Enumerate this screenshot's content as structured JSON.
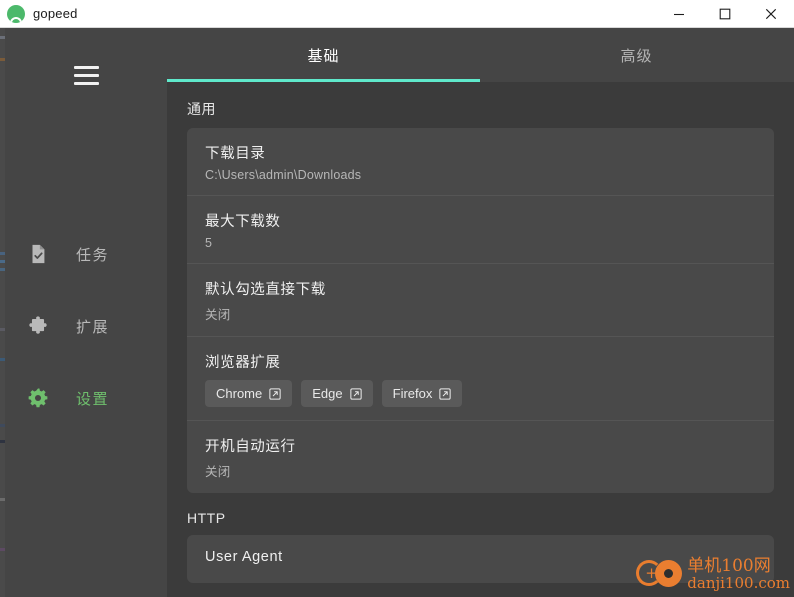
{
  "window": {
    "title": "gopeed",
    "logo_icon": "gopeed-logo-icon",
    "controls": {
      "minimize": "minimize-icon",
      "maximize": "maximize-icon",
      "close": "close-icon"
    }
  },
  "sidebar": {
    "menu_icon": "hamburger-menu-icon",
    "items": [
      {
        "label": "任务",
        "icon": "task-document-icon",
        "active": false
      },
      {
        "label": "扩展",
        "icon": "puzzle-piece-icon",
        "active": false
      },
      {
        "label": "设置",
        "icon": "gear-icon",
        "active": true
      }
    ]
  },
  "tabs": [
    {
      "label": "基础",
      "active": true
    },
    {
      "label": "高级",
      "active": false
    }
  ],
  "sections": [
    {
      "title": "通用",
      "rows": [
        {
          "label": "下载目录",
          "value": "C:\\Users\\admin\\Downloads"
        },
        {
          "label": "最大下载数",
          "value": "5"
        },
        {
          "label": "默认勾选直接下载",
          "value": "关闭"
        },
        {
          "label": "浏览器扩展",
          "value": "",
          "chips": [
            {
              "label": "Chrome",
              "icon": "external-link-icon"
            },
            {
              "label": "Edge",
              "icon": "external-link-icon"
            },
            {
              "label": "Firefox",
              "icon": "external-link-icon"
            }
          ]
        },
        {
          "label": "开机自动运行",
          "value": "关闭"
        }
      ]
    },
    {
      "title": "HTTP",
      "rows": [
        {
          "label": "User Agent",
          "value": ""
        }
      ]
    }
  ],
  "watermark": {
    "line1": "单机100网",
    "line2": "danji100.com",
    "plus": "+"
  },
  "colors": {
    "accent_tab": "#5fe9cb",
    "accent_nav_active": "#6fbf6d",
    "card_bg": "#494949",
    "page_bg": "#3b3b3b",
    "sidebar_bg": "#454545",
    "watermark": "#f08030"
  }
}
